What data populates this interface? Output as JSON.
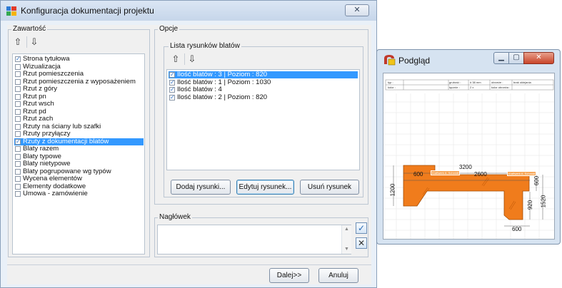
{
  "main_window": {
    "title": "Konfiguracja dokumentacji projektu",
    "close_label": "✕"
  },
  "content_panel": {
    "group_label": "Zawartość",
    "items": [
      {
        "label": "Strona tytułowa",
        "checked": true,
        "selected": false
      },
      {
        "label": "Wizualizacja",
        "checked": false,
        "selected": false
      },
      {
        "label": "Rzut pomieszczenia",
        "checked": false,
        "selected": false
      },
      {
        "label": "Rzut pomieszczenia z wyposażeniem",
        "checked": false,
        "selected": false
      },
      {
        "label": "Rzut z góry",
        "checked": false,
        "selected": false
      },
      {
        "label": "Rzut pn",
        "checked": false,
        "selected": false
      },
      {
        "label": "Rzut wsch",
        "checked": false,
        "selected": false
      },
      {
        "label": "Rzut pd",
        "checked": false,
        "selected": false
      },
      {
        "label": "Rzut zach",
        "checked": false,
        "selected": false
      },
      {
        "label": "Rzuty na ściany lub szafki",
        "checked": false,
        "selected": false
      },
      {
        "label": "Rzuty przyłączy",
        "checked": false,
        "selected": false
      },
      {
        "label": "Rzuty z dokumentacji blatów",
        "checked": true,
        "selected": true
      },
      {
        "label": "Blaty razem",
        "checked": false,
        "selected": false
      },
      {
        "label": "Blaty typowe",
        "checked": false,
        "selected": false
      },
      {
        "label": "Blaty nietypowe",
        "checked": false,
        "selected": false
      },
      {
        "label": "Blaty pogrupowane wg typów",
        "checked": false,
        "selected": false
      },
      {
        "label": "Wycena elementów",
        "checked": false,
        "selected": false
      },
      {
        "label": "Elementy dodatkowe",
        "checked": false,
        "selected": false
      },
      {
        "label": "Umowa - zamówienie",
        "checked": false,
        "selected": false
      }
    ]
  },
  "options_panel": {
    "group_label": "Opcje",
    "drawings_group_label": "Lista rysunków blatów",
    "drawings": [
      {
        "label": "Ilość blatów : 3  |  Poziom : 820",
        "checked": true,
        "selected": true
      },
      {
        "label": "Ilość blatów : 1  |  Poziom : 1030",
        "checked": true,
        "selected": false
      },
      {
        "label": "Ilość blatów : 4",
        "checked": true,
        "selected": false
      },
      {
        "label": "Ilość blatów : 2  |  Poziom : 820",
        "checked": true,
        "selected": false
      }
    ],
    "add_button": "Dodaj rysunki...",
    "edit_button": "Edytuj rysunek...",
    "remove_button": "Usuń rysunek"
  },
  "header_panel": {
    "group_label": "Nagłówek",
    "value": ""
  },
  "footer": {
    "next_button": "Dalej>>",
    "cancel_button": "Anuluj"
  },
  "preview_window": {
    "title": "Podgląd",
    "table": {
      "row1": [
        "typ :",
        "grubość :",
        "# 38 mm",
        "obrzeże :",
        "brak oklejania"
      ],
      "row2": [
        "kolor :",
        "łącznie :",
        "2 x",
        "kolor obrzeża :",
        ""
      ]
    },
    "dimensions": [
      "3200",
      "600",
      "2600",
      "1200",
      "600",
      "1520",
      "920",
      "600"
    ],
    "part_labels": [
      "Kraftwerk A. Schmidt",
      "Kraftwerk A. Schmidt"
    ],
    "countertop_color": "#f07c1c"
  },
  "colors": {
    "accent": "#3399ff",
    "window_frame": "#e9f0f8"
  }
}
